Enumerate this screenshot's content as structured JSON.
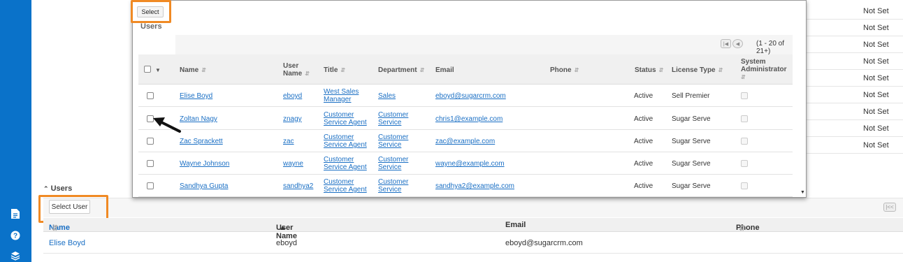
{
  "sidebar": {
    "icons": [
      "document-icon",
      "help-icon",
      "layers-icon"
    ]
  },
  "background": {
    "column_values": [
      "Not Set",
      "Not Set",
      "Not Set",
      "Not Set",
      "Not Set",
      "Not Set",
      "Not Set",
      "Not Set",
      "Not Set"
    ],
    "subpanel": {
      "title": "Users",
      "select_user_label": "Select User",
      "columns": {
        "name": "Name",
        "user_name": "User Name",
        "email": "Email",
        "phone": "Phone"
      },
      "rows": [
        {
          "name": "Elise Boyd",
          "user_name": "eboyd",
          "email": "eboyd@sugarcrm.com",
          "phone": ""
        }
      ]
    }
  },
  "modal": {
    "select_label": "Select",
    "title": "Users",
    "pagination": "(1 - 20 of 21+)",
    "columns": {
      "name": "Name",
      "user_name_1": "User",
      "user_name_2": "Name",
      "title": "Title",
      "department": "Department",
      "email": "Email",
      "phone": "Phone",
      "status": "Status",
      "license_type": "License Type",
      "sysadmin_1": "System",
      "sysadmin_2": "Administrator"
    },
    "rows": [
      {
        "name": "Elise Boyd",
        "user_name": "eboyd",
        "title_1": "West Sales",
        "title_2": "Manager",
        "dept_1": "Sales",
        "dept_2": "",
        "email": "eboyd@sugarcrm.com",
        "phone": "",
        "status": "Active",
        "license": "Sell Premier"
      },
      {
        "name": "Zoltan Nagy",
        "user_name": "znagy",
        "title_1": "Customer",
        "title_2": "Service Agent",
        "dept_1": "Customer",
        "dept_2": "Service",
        "email": "chris1@example.com",
        "phone": "",
        "status": "Active",
        "license": "Sugar Serve"
      },
      {
        "name": "Zac Sprackett",
        "user_name": "zac",
        "title_1": "Customer",
        "title_2": "Service Agent",
        "dept_1": "Customer",
        "dept_2": "Service",
        "email": "zac@example.com",
        "phone": "",
        "status": "Active",
        "license": "Sugar Serve"
      },
      {
        "name": "Wayne Johnson",
        "user_name": "wayne",
        "title_1": "Customer",
        "title_2": "Service Agent",
        "dept_1": "Customer",
        "dept_2": "Service",
        "email": "wayne@example.com",
        "phone": "",
        "status": "Active",
        "license": "Sugar Serve"
      },
      {
        "name": "Sandhya Gupta",
        "user_name": "sandhya2",
        "title_1": "Customer",
        "title_2": "Service Agent",
        "dept_1": "Customer",
        "dept_2": "Service",
        "email": "sandhya2@example.com",
        "phone": "",
        "status": "Active",
        "license": "Sugar Serve"
      }
    ]
  },
  "colors": {
    "sidebar": "#0a72c9",
    "link": "#1a6fc4",
    "highlight": "#f08a24"
  }
}
